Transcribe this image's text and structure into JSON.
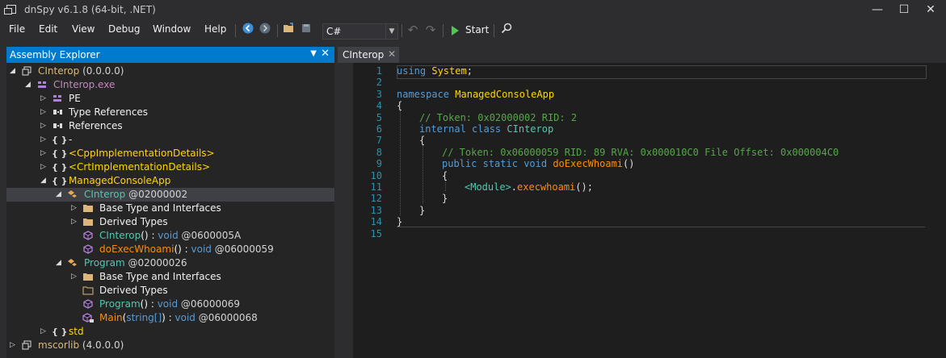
{
  "window": {
    "title": "dnSpy v6.1.8 (64-bit, .NET)",
    "minimize": "—",
    "maximize": "☐",
    "close": "✕"
  },
  "menu": [
    "File",
    "Edit",
    "View",
    "Debug",
    "Window",
    "Help"
  ],
  "toolbar": {
    "language": "C#",
    "start_label": "Start",
    "icons": [
      "back-icon",
      "forward-icon",
      "open-icon",
      "save-icon",
      "undo-icon",
      "redo-icon",
      "start-icon",
      "search-icon"
    ]
  },
  "assembly_explorer": {
    "title": "Assembly Explorer",
    "tree": [
      {
        "indent": 0,
        "exp": "◢",
        "icon": "assembly-icon",
        "text": "CInterop",
        "suffix": " (0.0.0.0)",
        "cls": "c-asm"
      },
      {
        "indent": 1,
        "exp": "◢",
        "icon": "module-icon",
        "text": "CInterop.exe",
        "suffix": "",
        "cls": "c-mod"
      },
      {
        "indent": 2,
        "exp": "▷",
        "icon": "pe-icon",
        "text": "PE",
        "suffix": "",
        "cls": "c-white"
      },
      {
        "indent": 2,
        "exp": "▷",
        "icon": "type-references-icon",
        "text": "Type References",
        "suffix": "",
        "cls": "c-white"
      },
      {
        "indent": 2,
        "exp": "▷",
        "icon": "references-icon",
        "text": "References",
        "suffix": "",
        "cls": "c-white"
      },
      {
        "indent": 2,
        "exp": "▷",
        "icon": "namespace-icon",
        "text": "-",
        "suffix": "",
        "cls": "c-white"
      },
      {
        "indent": 2,
        "exp": "▷",
        "icon": "namespace-icon",
        "text": "<CppImplementationDetails>",
        "suffix": "",
        "cls": "c-ns"
      },
      {
        "indent": 2,
        "exp": "▷",
        "icon": "namespace-icon",
        "text": "<CrtImplementationDetails>",
        "suffix": "",
        "cls": "c-ns"
      },
      {
        "indent": 2,
        "exp": "◢",
        "icon": "namespace-icon",
        "text": "ManagedConsoleApp",
        "suffix": "",
        "cls": "c-ns"
      },
      {
        "indent": 3,
        "exp": "◢",
        "icon": "class-icon",
        "text": "CInterop",
        "suffix": " @02000002",
        "cls": "c-ty",
        "selected": true
      },
      {
        "indent": 4,
        "exp": "▷",
        "icon": "folder-icon",
        "text": "Base Type and Interfaces",
        "suffix": "",
        "cls": "c-white"
      },
      {
        "indent": 4,
        "exp": "▷",
        "icon": "folder-icon",
        "text": "Derived Types",
        "suffix": "",
        "cls": "c-white"
      },
      {
        "indent": 4,
        "exp": "",
        "icon": "method-icon",
        "text": "CInterop",
        "paren": "()",
        "colon": " : ",
        "ret": "void",
        "suffix": " @0600005A",
        "cls": "c-meth"
      },
      {
        "indent": 4,
        "exp": "",
        "icon": "method-icon",
        "text": "doExecWhoami",
        "paren": "()",
        "colon": " : ",
        "ret": "void",
        "suffix": " @06000059",
        "cls": "c-meth2"
      },
      {
        "indent": 3,
        "exp": "◢",
        "icon": "class-icon",
        "text": "Program",
        "suffix": " @02000026",
        "cls": "c-ty"
      },
      {
        "indent": 4,
        "exp": "▷",
        "icon": "folder-icon",
        "text": "Base Type and Interfaces",
        "suffix": "",
        "cls": "c-white"
      },
      {
        "indent": 4,
        "exp": "",
        "icon": "folder-open-icon",
        "text": "Derived Types",
        "suffix": "",
        "cls": "c-white"
      },
      {
        "indent": 4,
        "exp": "",
        "icon": "method-icon",
        "text": "Program",
        "paren": "()",
        "colon": " : ",
        "ret": "void",
        "suffix": " @06000069",
        "cls": "c-meth"
      },
      {
        "indent": 4,
        "exp": "",
        "icon": "method-private-icon",
        "text": "Main",
        "paren": "(",
        "arg": "string[]",
        "paren2": ")",
        "colon": " : ",
        "ret": "void",
        "suffix": " @06000068",
        "cls": "c-meth2"
      },
      {
        "indent": 2,
        "exp": "▷",
        "icon": "namespace-icon",
        "text": "std",
        "suffix": "",
        "cls": "c-ns"
      },
      {
        "indent": 0,
        "exp": "▷",
        "icon": "assembly-icon",
        "text": "mscorlib",
        "suffix": " (4.0.0.0)",
        "cls": "c-asm"
      }
    ]
  },
  "editor": {
    "tab_label": "CInterop",
    "tab_close": "✕",
    "line_numbers": [
      "1",
      "2",
      "3",
      "4",
      "5",
      "6",
      "7",
      "8",
      "9",
      "10",
      "11",
      "12",
      "13",
      "14",
      "15"
    ],
    "code": {
      "l1_kw": "using",
      "l1_ns": "System",
      "l1_end": ";",
      "l3_kw": "namespace",
      "l3_ns": "ManagedConsoleApp",
      "l4": "{",
      "l5": "// Token: 0x02000002 RID: 2",
      "l6_kw1": "internal",
      "l6_kw2": "class",
      "l6_cls": "CInterop",
      "l7": "{",
      "l8": "// Token: 0x06000059 RID: 89 RVA: 0x000010C0 File Offset: 0x000004C0",
      "l9_kw1": "public",
      "l9_kw2": "static",
      "l9_kw3": "void",
      "l9_m": "doExecWhoami",
      "l9_p": "()",
      "l10": "{",
      "l11_mod": "<Module>",
      "l11_dot": ".",
      "l11_m": "execwhoami",
      "l11_end": "();",
      "l12": "}",
      "l13": "}",
      "l14": "}"
    }
  }
}
